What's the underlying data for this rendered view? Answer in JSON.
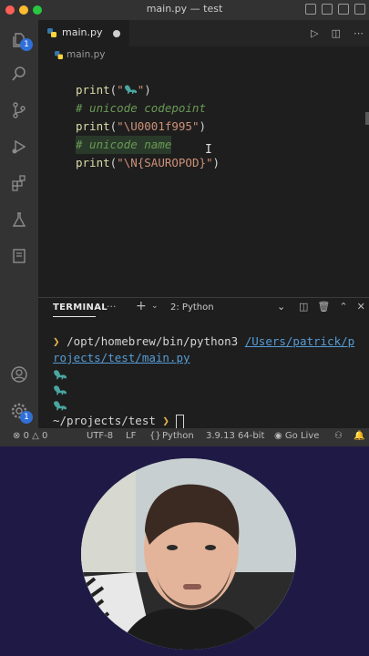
{
  "window": {
    "title": "main.py — test"
  },
  "tab": {
    "filename": "main.py"
  },
  "breadcrumb": {
    "file": "main.py"
  },
  "editor": {
    "lines": [
      {
        "prefix": "print(\"",
        "emoji": "🦕",
        "suffix": "\")"
      },
      {
        "comment": "# unicode codepoint"
      },
      {
        "prefix": "print(\"",
        "string": "\\U0001f995",
        "suffix": "\")"
      },
      {
        "comment": "# unicode name"
      },
      {
        "prefix": "print(\"",
        "string": "\\N{SAUROPOD}",
        "suffix": "\")"
      }
    ]
  },
  "badges": {
    "explorer": "1",
    "settings": "1"
  },
  "panel": {
    "tab": "TERMINAL",
    "more": "···",
    "plus": "+",
    "shell_select": "2: Python"
  },
  "terminal": {
    "command_exe": "/opt/homebrew/bin/python3",
    "command_arg_1": "/Users/patrick/p",
    "command_arg_2": "rojects/test/main.py",
    "prompt_path": "~/projects/test",
    "prompt_symbol": "❯"
  },
  "statusbar": {
    "errors": "0",
    "warnings": "0",
    "encoding": "UTF-8",
    "eol": "LF",
    "language": "Python",
    "interpreter": "3.9.13 64-bit",
    "golive": "Go Live"
  },
  "colors": {
    "close": "#ff5f57",
    "minimize": "#febc2e",
    "maximize": "#28c840",
    "badge": "#2f6fd8",
    "dino": "#4aa6a0"
  }
}
